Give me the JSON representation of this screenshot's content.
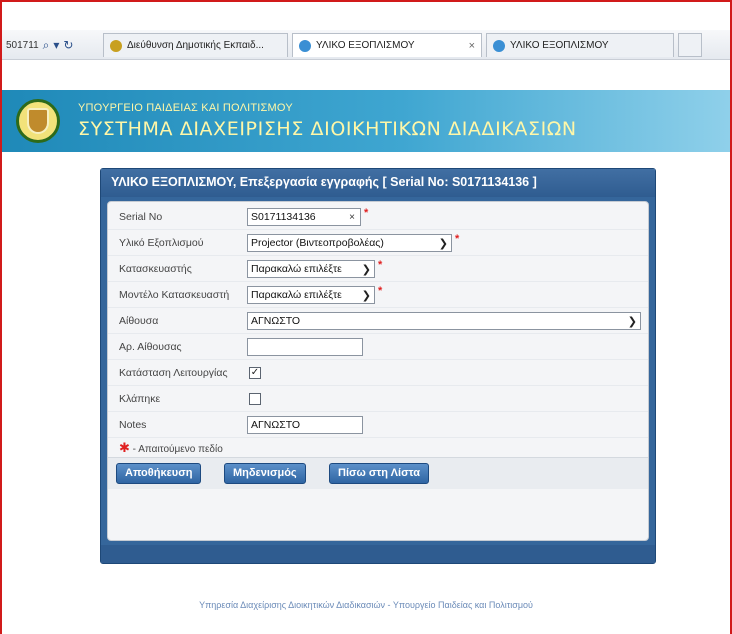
{
  "browser": {
    "address_fragment": "501711",
    "tabs": [
      {
        "label": "Διεύθυνση Δημοτικής Εκπαιδ...",
        "active": false,
        "favicon_color": "#c8a020"
      },
      {
        "label": "ΥΛΙΚΟ ΕΞΟΠΛΙΣΜΟΥ",
        "active": true,
        "close": "×",
        "favicon_color": "#3a8fd4"
      },
      {
        "label": "ΥΛΙΚΟ ΕΞΟΠΛΙΣΜΟΥ",
        "active": false,
        "favicon_color": "#3a8fd4"
      }
    ]
  },
  "header": {
    "ministry": "ΥΠΟΥΡΓΕΙΟ ΠΑΙΔΕΙΑΣ ΚΑΙ ΠΟΛΙΤΙΣΜΟΥ",
    "system": "ΣΥΣΤΗΜΑ ΔΙΑΧΕΙΡΙΣΗΣ ΔΙΟΙΚΗΤΙΚΩΝ ΔΙΑΔΙΚΑΣΙΩΝ"
  },
  "panel": {
    "title": "ΥΛΙΚΟ ΕΞΟΠΛΙΣΜΟΥ, Επεξεργασία εγγραφής [ Serial No: S0171134136 ]"
  },
  "form": {
    "serial": {
      "label": "Serial No",
      "value": "S0171134136",
      "clear": "×",
      "required": "*"
    },
    "equipment": {
      "label": "Υλικό Εξοπλισμού",
      "value": "Projector (Βιντεοπροβολέας)",
      "required": "*"
    },
    "manufacturer": {
      "label": "Κατασκευαστής",
      "value": "Παρακαλώ επιλέξτε",
      "required": "*"
    },
    "model": {
      "label": "Μοντέλο Κατασκευαστή",
      "value": "Παρακαλώ επιλέξτε",
      "required": "*"
    },
    "room": {
      "label": "Αίθουσα",
      "value": "ΑΓΝΩΣΤΟ"
    },
    "room_number": {
      "label": "Αρ. Αίθουσας",
      "value": ""
    },
    "operational": {
      "label": "Κατάσταση Λειτουργίας",
      "checked": true,
      "mark": "✓"
    },
    "stolen": {
      "label": "Κλάπηκε",
      "checked": false
    },
    "notes": {
      "label": "Notes",
      "value": "ΑΓΝΩΣΤΟ"
    },
    "required_legend": {
      "star": "✱",
      "text": " - Απαιτούμενο πεδίο"
    }
  },
  "buttons": {
    "save": "Αποθήκευση",
    "reset": "Μηδενισμός",
    "back": "Πίσω στη Λίστα"
  },
  "footer": "Υπηρεσία Διαχείρισης Διοικητικών Διαδικασιών - Υπουργείο Παιδείας και Πολιτισμού"
}
